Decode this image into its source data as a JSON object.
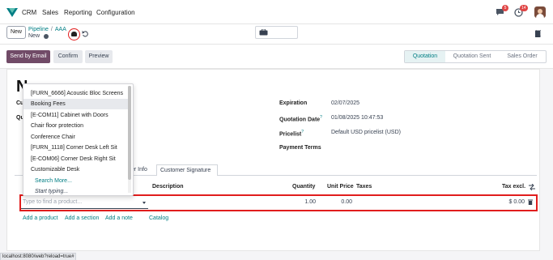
{
  "topbar": {
    "app_name": "CRM",
    "menu": [
      "Sales",
      "Reporting",
      "Configuration"
    ],
    "chat_badge": "5",
    "activity_badge": "14"
  },
  "control": {
    "new_label": "New",
    "breadcrumb_parent": "Pipeline",
    "breadcrumb_separator": "/",
    "breadcrumb_current": "AAA",
    "record_name": "New"
  },
  "actions": {
    "send_by_email": "Send by Email",
    "confirm": "Confirm",
    "preview": "Preview"
  },
  "status_steps": [
    "Quotation",
    "Quotation Sent",
    "Sales Order"
  ],
  "form": {
    "title_char": "N",
    "left_stub_1": "Cu",
    "left_stub_2": "Qu",
    "expiration_label": "Expiration",
    "expiration_value": "02/07/2025",
    "quotation_date_label": "Quotation Date",
    "quotation_date_value": "01/08/2025 10:47:53",
    "pricelist_label": "Pricelist",
    "pricelist_value": "Default USD pricelist (USD)",
    "payment_terms_label": "Payment Terms",
    "help_mark": "?"
  },
  "tabs": [
    "er Info",
    "Customer Signature"
  ],
  "table": {
    "headers": {
      "description": "Description",
      "quantity": "Quantity",
      "unit_price": "Unit Price",
      "taxes": "Taxes",
      "tax_excl": "Tax excl."
    },
    "product_placeholder": "Type to find a product...",
    "quantity": "1.00",
    "unit_price": "0.00",
    "tax_excl": "$ 0.00"
  },
  "links": {
    "add_product": "Add a product",
    "add_section": "Add a section",
    "add_note": "Add a note",
    "catalog": "Catalog"
  },
  "dropdown": {
    "items": [
      "[FURN_6666] Acoustic Bloc Screens",
      "Booking Fees",
      "[E-COM11] Cabinet with Doors",
      "Chair floor protection",
      "Conference Chair",
      "[FURN_1118] Corner Desk Left Sit",
      "[E-COM06] Corner Desk Right Sit",
      "Customizable Desk"
    ],
    "search_more": "Search More...",
    "start_typing": "Start typing..."
  },
  "url": "localhost:8080/web?reload=true#",
  "colors": {
    "primary": "#714b67",
    "accent": "#017e84",
    "highlight": "#e11d1d"
  }
}
